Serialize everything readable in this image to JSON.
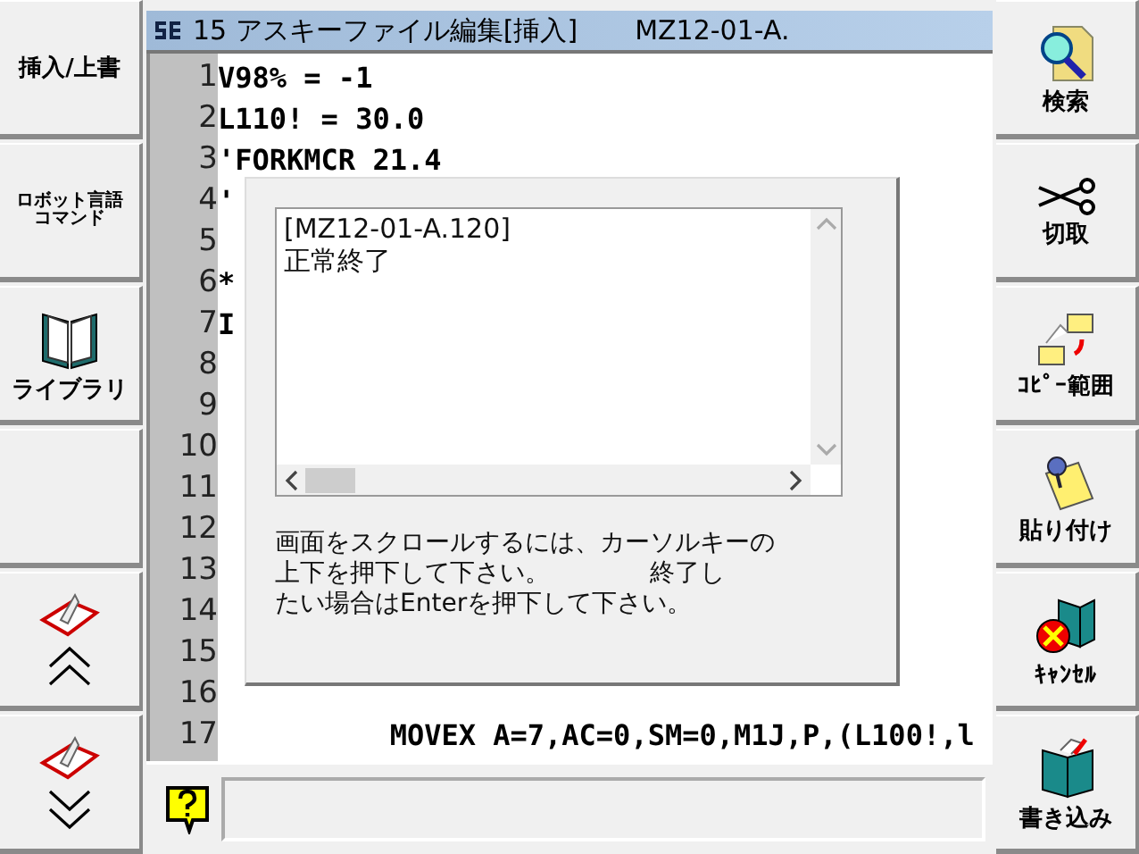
{
  "left_buttons": [
    {
      "kind": "text",
      "label": "挿入/上書"
    },
    {
      "kind": "text_small",
      "label": "ロボット言語コマンド"
    },
    {
      "kind": "library",
      "label": "ライブラリ"
    },
    {
      "kind": "blank"
    },
    {
      "kind": "page_up"
    },
    {
      "kind": "page_down"
    }
  ],
  "window": {
    "title": "15 アスキーファイル編集[挿入]",
    "file": "MZ12-01-A."
  },
  "lines": [
    {
      "number": "1",
      "text": "V98% = -1"
    },
    {
      "number": "2",
      "text": "L110! = 30.0"
    },
    {
      "number": "3",
      "text": "'FORKMCR 21.4"
    },
    {
      "number": "4",
      "text": "'"
    },
    {
      "number": "5"
    },
    {
      "number": "6",
      "text": "*"
    },
    {
      "number": "7",
      "text": "I"
    },
    {
      "number": "8"
    },
    {
      "number": "9"
    },
    {
      "number": "10"
    },
    {
      "number": "11"
    },
    {
      "number": "12"
    },
    {
      "number": "13"
    },
    {
      "number": "14"
    },
    {
      "number": "15"
    },
    {
      "number": "16"
    },
    {
      "number": "17",
      "text": "          MOVEX A=7,AC=0,SM=0,M1J,P,(L100!,l"
    }
  ],
  "dialog": {
    "log": [
      "[MZ12-01-A.120]",
      "正常終了"
    ],
    "message_lines": [
      "画面をスクロールするには、カーソルキーの",
      "上下を押下して下さい。　　　　終了し",
      "たい場合はEnterを押下して下さい。"
    ]
  },
  "right_buttons": [
    {
      "kind": "search",
      "label": "検索"
    },
    {
      "kind": "cut",
      "label": "切取"
    },
    {
      "kind": "copy",
      "label": "ｺﾋﾟｰ範囲"
    },
    {
      "kind": "paste",
      "label": "貼り付け"
    },
    {
      "kind": "cancel",
      "label": "ｷｬﾝｾﾙ"
    },
    {
      "kind": "write",
      "label": "書き込み"
    }
  ]
}
